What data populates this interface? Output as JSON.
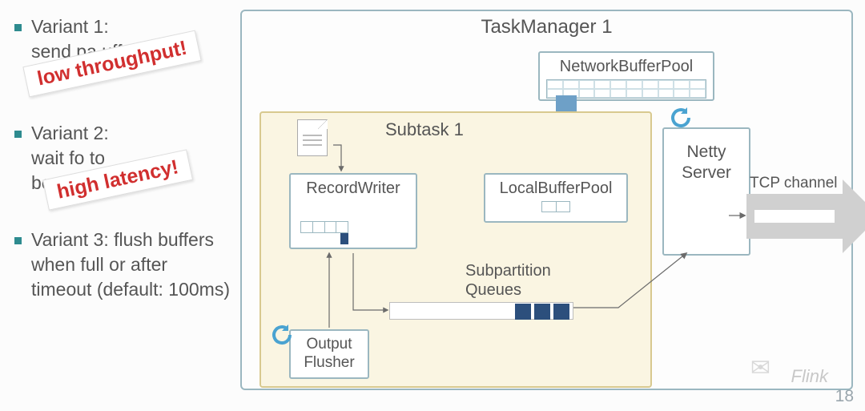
{
  "bullets": {
    "v1": "Variant 1:\nsend pa            uffer\nri                 ay",
    "v2": "Variant 2:\nwait fo                  to\nbe           e full",
    "v3": "Variant 3:\nflush buffers when full or after timeout (default: 100ms)"
  },
  "stamps": {
    "s1": "low throughput!",
    "s2": "high latency!"
  },
  "diagram": {
    "taskmanager_title": "TaskManager 1",
    "subtask_title": "Subtask 1",
    "recordwriter": "RecordWriter",
    "localbuffer": "LocalBufferPool",
    "netbuffer": "NetworkBufferPool",
    "outputflusher": "Output\nFlusher",
    "queues_label": "Subpartition\nQueues",
    "netty": "Netty\nServer",
    "tcp": "TCP channel"
  },
  "footer": {
    "page": "18",
    "watermark": "Flink",
    "wechat_glyph": "✉"
  }
}
